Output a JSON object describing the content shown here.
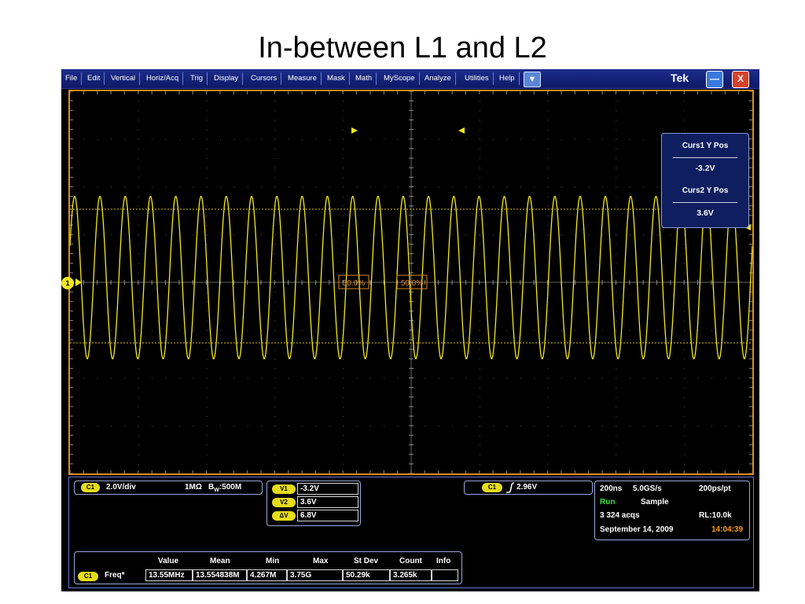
{
  "slide": {
    "title": "In-between L1 and L2"
  },
  "menu": {
    "items": [
      "File",
      "Edit",
      "Vertical",
      "Horiz/Acq",
      "Trig",
      "Display",
      "Cursors",
      "Measure",
      "Mask",
      "Math",
      "MyScope",
      "Analyze",
      "Utilities",
      "Help"
    ],
    "dropdown_icon": "▼",
    "logo": "Tek",
    "minimize_icon": "—",
    "close_icon": "X"
  },
  "cursors": {
    "curs1_label": "Curs1 Y Pos",
    "curs1_value": "-3.2V",
    "curs2_label": "Curs2 Y Pos",
    "curs2_value": "3.6V"
  },
  "markers": {
    "channel": "1",
    "ref_left": "50.0%",
    "ref_right": "50.0%"
  },
  "channel": {
    "tag": "C1",
    "scale": "2.0V/div",
    "coupling": "1MΩ",
    "bw_prefix": "B",
    "bw_sub": "W",
    "bandwidth": ":500M"
  },
  "cursor_readout": {
    "v1_tag": "V1",
    "v1": "-3.2V",
    "v2_tag": "V2",
    "v2": "3.6V",
    "dv_tag": "ΔV",
    "dv": "6.8V"
  },
  "trigger": {
    "tag": "C1",
    "level": "2.96V"
  },
  "acquisition": {
    "timebase": "200ns",
    "sample_rate": "5.0GS/s",
    "resolution": "200ps/pt",
    "state": "Run",
    "mode": "Sample",
    "acqs": "3 324 acqs",
    "record_length": "RL:10.0k",
    "date": "September 14, 2009",
    "time": "14:04:39"
  },
  "measurements": {
    "headers": [
      "Value",
      "Mean",
      "Min",
      "Max",
      "St Dev",
      "Count",
      "Info"
    ],
    "row_tag": "C1",
    "row_name": "Freq*",
    "values": [
      "13.55MHz",
      "13.554838M",
      "4.267M",
      "3.75G",
      "50.29k",
      "3.265k",
      ""
    ]
  },
  "colors": {
    "trace": "#f3e81e",
    "frame": "#e08a1c",
    "menubar": "#14237a",
    "run": "#27e337",
    "time": "#ff9c1a"
  },
  "waveform": {
    "cycles": 27,
    "amplitude_v": 3.4,
    "offset_v": 0.2,
    "volts_per_div": 2.0
  }
}
